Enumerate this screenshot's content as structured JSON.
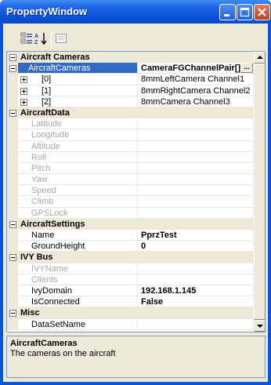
{
  "window": {
    "title": "PropertyWindow"
  },
  "toolbar": {
    "categorized_icon": "categorized-icon",
    "alphabetical_icon": "alphabetical-sort-icon",
    "property_pages_icon": "property-pages-icon"
  },
  "grid": {
    "rows": [
      {
        "type": "category",
        "label": "Aircraft Cameras"
      },
      {
        "type": "property",
        "name": "AircraftCameras",
        "value": "CameraFGChannelPair[] Ar...",
        "selected": true,
        "bold": true,
        "expandable": true
      },
      {
        "type": "sub",
        "name": "[0]",
        "value": "8mmLeftCamera Channel1"
      },
      {
        "type": "sub",
        "name": "[1]",
        "value": "8mmRightCamera Channel2"
      },
      {
        "type": "sub",
        "name": "[2]",
        "value": "8mmCamera Channel3"
      },
      {
        "type": "category",
        "label": "AircraftData"
      },
      {
        "type": "property",
        "name": "Latitude",
        "value": "",
        "disabled": true
      },
      {
        "type": "property",
        "name": "Longitude",
        "value": "",
        "disabled": true
      },
      {
        "type": "property",
        "name": "Altitude",
        "value": "",
        "disabled": true
      },
      {
        "type": "property",
        "name": "Roll",
        "value": "",
        "disabled": true
      },
      {
        "type": "property",
        "name": "Pitch",
        "value": "",
        "disabled": true
      },
      {
        "type": "property",
        "name": "Yaw",
        "value": "",
        "disabled": true
      },
      {
        "type": "property",
        "name": "Speed",
        "value": "",
        "disabled": true
      },
      {
        "type": "property",
        "name": "Climb",
        "value": "",
        "disabled": true
      },
      {
        "type": "property",
        "name": "GPSLock",
        "value": "",
        "disabled": true
      },
      {
        "type": "category",
        "label": "AircraftSettings"
      },
      {
        "type": "property",
        "name": "Name",
        "value": "PprzTest",
        "bold": true
      },
      {
        "type": "property",
        "name": "GroundHeight",
        "value": "0",
        "bold": true
      },
      {
        "type": "category",
        "label": "IVY Bus"
      },
      {
        "type": "property",
        "name": "IVYName",
        "value": "",
        "disabled": true
      },
      {
        "type": "property",
        "name": "Clients",
        "value": "",
        "disabled": true
      },
      {
        "type": "property",
        "name": "IvyDomain",
        "value": "192.168.1.145",
        "bold": true
      },
      {
        "type": "property",
        "name": "IsConnected",
        "value": "False",
        "bold": true
      },
      {
        "type": "category",
        "label": "Misc"
      },
      {
        "type": "property",
        "name": "DataSetName",
        "value": ""
      }
    ]
  },
  "description": {
    "title": "AircraftCameras",
    "text": "The cameras on the aircraft"
  },
  "colors": {
    "title_bar": "#0a56d8",
    "selection": "#316ac5",
    "panel": "#ece9d8"
  }
}
